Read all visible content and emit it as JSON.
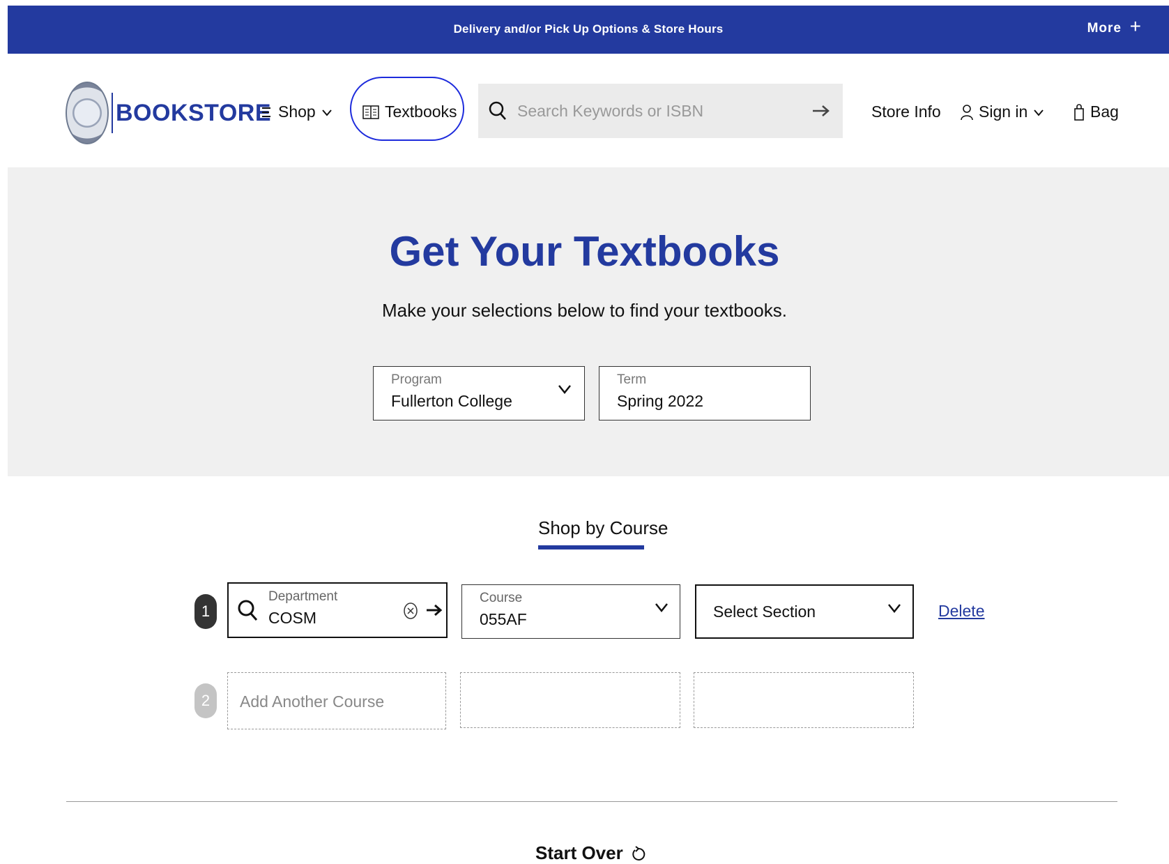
{
  "promo": {
    "text": "Delivery and/or Pick Up Options & Store Hours",
    "more": "More",
    "plus": "+"
  },
  "header": {
    "logo_text": "BOOKSTORE",
    "nav": {
      "shop": "Shop",
      "textbooks": "Textbooks",
      "store_info": "Store Info",
      "sign_in": "Sign in",
      "bag": "Bag"
    },
    "search": {
      "placeholder": "Search Keywords or ISBN"
    }
  },
  "hero": {
    "title": "Get Your Textbooks",
    "subtitle": "Make your selections below to find your textbooks.",
    "program": {
      "label": "Program",
      "value": "Fullerton College"
    },
    "term": {
      "label": "Term",
      "value": "Spring 2022"
    }
  },
  "tabs": {
    "shop_by_course": "Shop by Course"
  },
  "courses": {
    "row1": {
      "number": "1",
      "department_label": "Department",
      "department_value": "COSM",
      "course_label": "Course",
      "course_value": "055AF",
      "section_value": "Select Section",
      "delete": "Delete"
    },
    "row2": {
      "number": "2",
      "placeholder": "Add Another Course"
    }
  },
  "start_over": "Start Over",
  "colors": {
    "brand_blue": "#233a9f",
    "highlight_circle": "#1d2bdc",
    "hero_bg": "#f0f0f0"
  }
}
